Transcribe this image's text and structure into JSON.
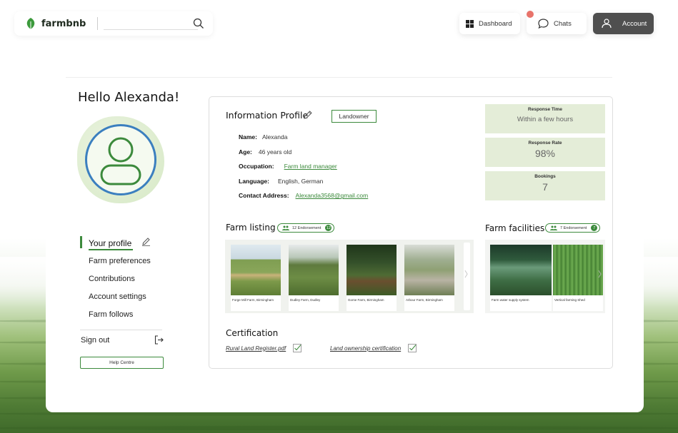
{
  "header": {
    "brand": "farmbnb",
    "search_placeholder": "",
    "nav": {
      "dashboard": "Dashboard",
      "chats": "Chats",
      "account": "Account"
    }
  },
  "greeting": "Hello Alexanda!",
  "sidebar": {
    "items": [
      {
        "label": "Your profile"
      },
      {
        "label": "Farm preferences"
      },
      {
        "label": "Contributions"
      },
      {
        "label": "Account settings"
      },
      {
        "label": "Farm follows"
      }
    ],
    "sign_out": "Sign out",
    "help": "Help Centre"
  },
  "profile": {
    "title": "Information Profile",
    "role_badge": "Landowner",
    "fields": {
      "name_label": "Name:",
      "name": "Alexanda",
      "age_label": "Age:",
      "age": "46 years old",
      "occupation_label": "Occupation:",
      "occupation": "Farm land manager",
      "language_label": "Language:",
      "language": "English, German",
      "contact_label": "Contact Address:",
      "contact": "Alexanda3568@gmail.com"
    }
  },
  "stats": {
    "response_time_label": "Response Time",
    "response_time": "Within a few hours",
    "response_rate_label": "Response Rate",
    "response_rate": "98%",
    "bookings_label": "Bookings",
    "bookings": "7"
  },
  "farm_listing": {
    "title": "Farm listing",
    "endorsement": "12 Endorsement",
    "count": "12",
    "items": [
      {
        "caption": "Forge Mill Farm, Birmingham"
      },
      {
        "caption": "Dudley Farm, Dudley"
      },
      {
        "caption": "Gorse Farm, Birmingham"
      },
      {
        "caption": "Arbour Farm, Birmingham"
      }
    ]
  },
  "farm_facilities": {
    "title": "Farm facilities",
    "endorsement": "7 Endorsement",
    "count": "7",
    "items": [
      {
        "caption": "Farm water supply system"
      },
      {
        "caption": "Vertical farming Shed"
      }
    ]
  },
  "certification": {
    "title": "Certification",
    "docs": [
      {
        "label": "Rural Land Register.pdf"
      },
      {
        "label": "Land ownership certification"
      }
    ]
  },
  "colors": {
    "accent_green": "#3c8a3c",
    "stat_bg": "#e4edd8",
    "account_btn": "#4f4f4f",
    "notification": "#e8736a"
  }
}
